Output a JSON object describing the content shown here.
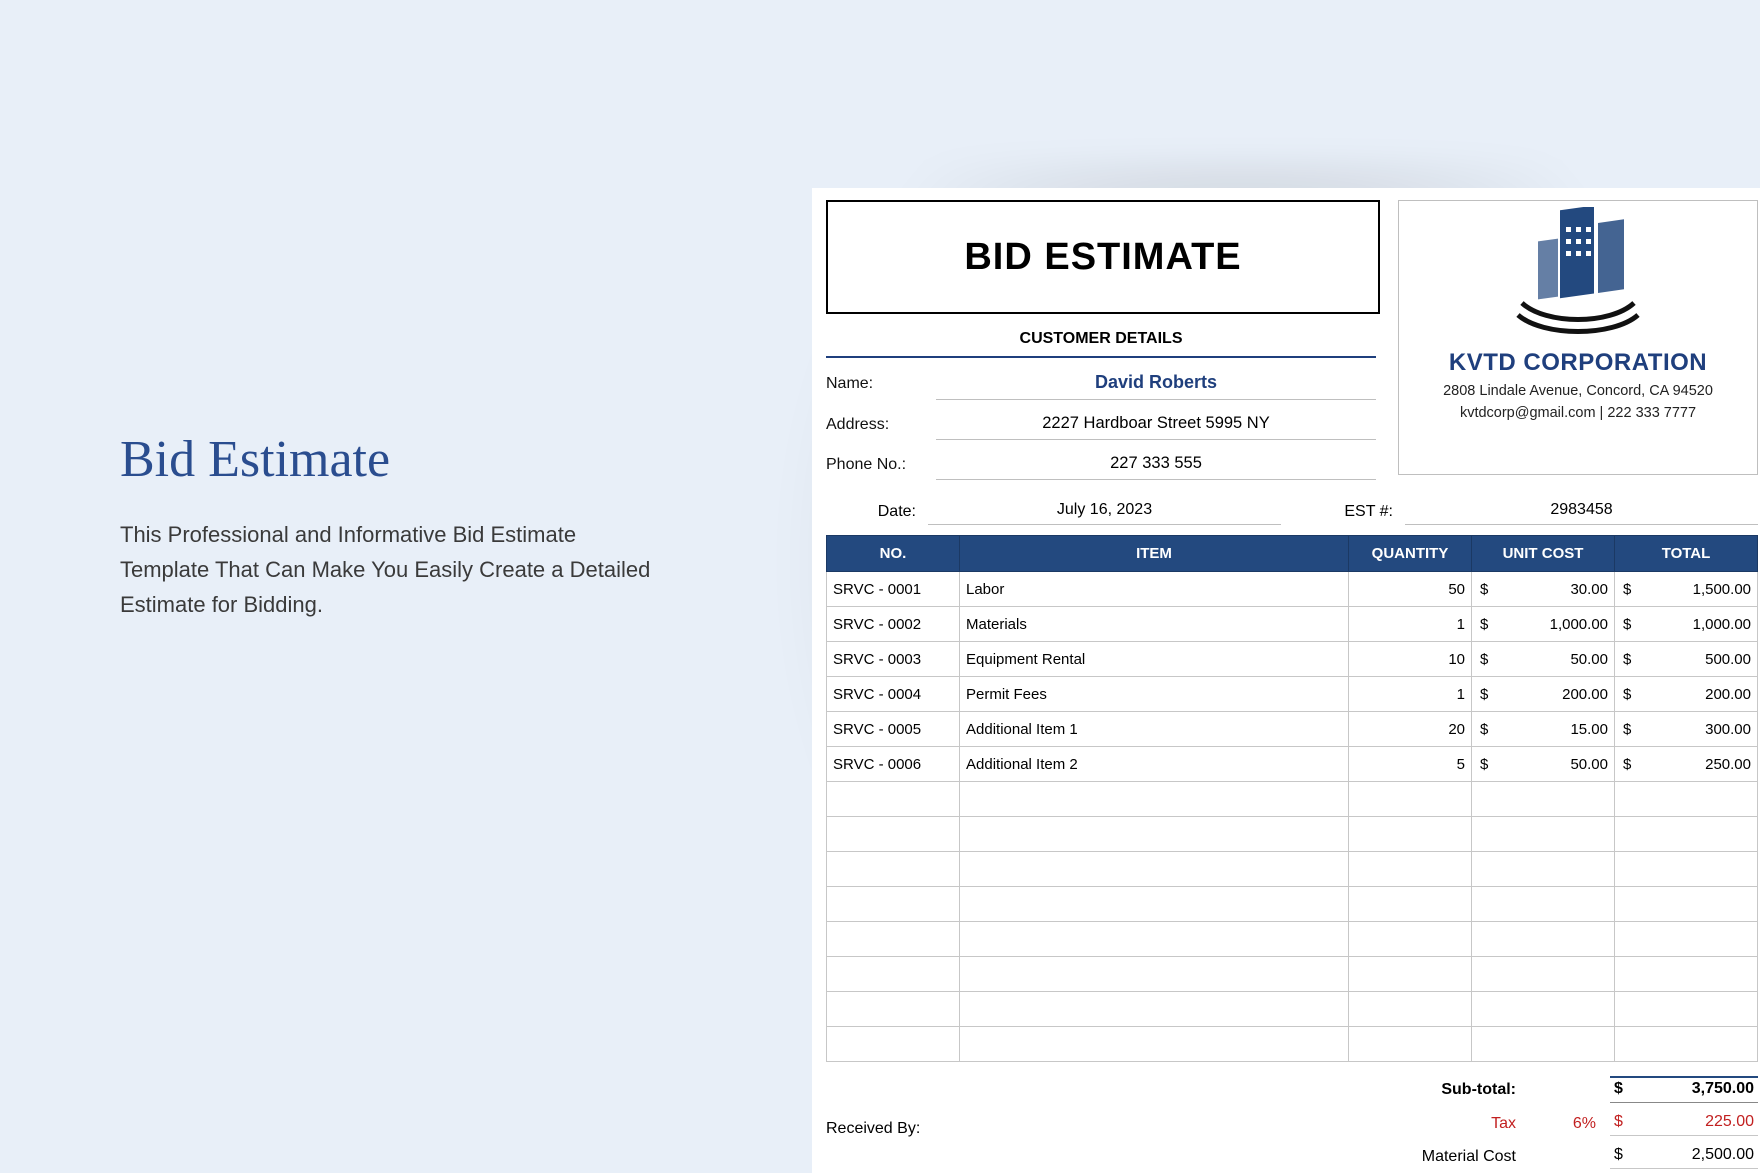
{
  "left": {
    "title": "Bid Estimate",
    "description": "This Professional and Informative Bid Estimate Template That Can Make You Easily Create a Detailed Estimate for Bidding."
  },
  "doc": {
    "title": "BID ESTIMATE",
    "customer_header": "CUSTOMER DETAILS",
    "labels": {
      "name": "Name:",
      "address": "Address:",
      "phone": "Phone No.:",
      "date": "Date:",
      "est": "EST #:",
      "received": "Received By:"
    },
    "customer": {
      "name": "David Roberts",
      "address": "2227 Hardboar Street 5995 NY",
      "phone": "227 333 555"
    },
    "date": "July 16, 2023",
    "est_no": "2983458",
    "company": {
      "name": "KVTD CORPORATION",
      "address": "2808 Lindale Avenue, Concord, CA 94520",
      "contact": "kvtdcorp@gmail.com | 222 333 7777"
    },
    "columns": {
      "no": "NO.",
      "item": "ITEM",
      "qty": "QUANTITY",
      "unit": "UNIT COST",
      "total": "TOTAL"
    },
    "currency": "$",
    "rows": [
      {
        "no": "SRVC - 0001",
        "item": "Labor",
        "qty": "50",
        "unit": "30.00",
        "total": "1,500.00"
      },
      {
        "no": "SRVC - 0002",
        "item": "Materials",
        "qty": "1",
        "unit": "1,000.00",
        "total": "1,000.00"
      },
      {
        "no": "SRVC - 0003",
        "item": "Equipment Rental",
        "qty": "10",
        "unit": "50.00",
        "total": "500.00"
      },
      {
        "no": "SRVC - 0004",
        "item": "Permit Fees",
        "qty": "1",
        "unit": "200.00",
        "total": "200.00"
      },
      {
        "no": "SRVC - 0005",
        "item": "Additional Item 1",
        "qty": "20",
        "unit": "15.00",
        "total": "300.00"
      },
      {
        "no": "SRVC - 0006",
        "item": "Additional Item 2",
        "qty": "5",
        "unit": "50.00",
        "total": "250.00"
      }
    ],
    "empty_rows": 8,
    "summary": {
      "subtotal_label": "Sub-total:",
      "subtotal": "3,750.00",
      "tax_label": "Tax",
      "tax_pct": "6%",
      "tax": "225.00",
      "material_label": "Material Cost",
      "material": "2,500.00"
    }
  }
}
